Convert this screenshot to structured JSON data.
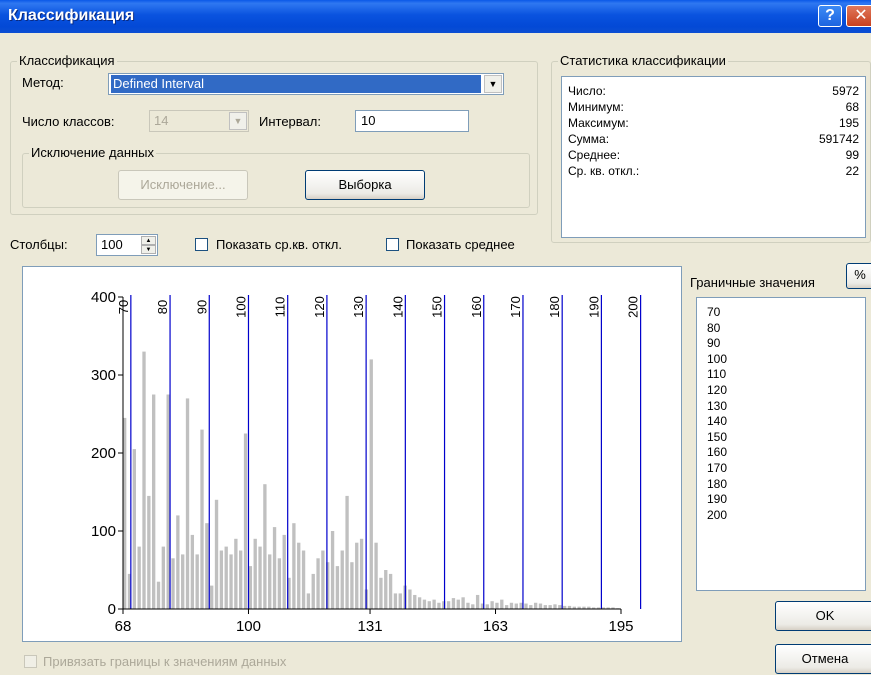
{
  "window": {
    "title": "Классификация"
  },
  "titlebar": {
    "help_glyph": "?",
    "close_glyph": "✕"
  },
  "classification": {
    "group_label": "Классификация",
    "method_label": "Метод:",
    "method_value": "Defined Interval",
    "classes_label": "Число классов:",
    "classes_value": "14",
    "interval_label": "Интервал:",
    "interval_value": "10"
  },
  "exclusion": {
    "group_label": "Исключение данных",
    "exclusion_button": "Исключение...",
    "sampling_button": "Выборка"
  },
  "statistics": {
    "group_label": "Статистика классификации",
    "rows": [
      {
        "key": "Число:",
        "value": "5972"
      },
      {
        "key": "Минимум:",
        "value": "68"
      },
      {
        "key": "Максимум:",
        "value": "195"
      },
      {
        "key": "Сумма:",
        "value": "591742"
      },
      {
        "key": "Среднее:",
        "value": "99"
      },
      {
        "key": "Ср. кв. откл.:",
        "value": "22"
      }
    ]
  },
  "columns": {
    "label": "Столбцы:",
    "value": "100",
    "show_std_label": "Показать ср.кв. откл.",
    "show_mean_label": "Показать среднее"
  },
  "breaks": {
    "label": "Граничные значения",
    "percent_button": "%",
    "values": [
      "70",
      "80",
      "90",
      "100",
      "110",
      "120",
      "130",
      "140",
      "150",
      "160",
      "170",
      "180",
      "190",
      "200"
    ]
  },
  "buttons": {
    "ok": "OK",
    "cancel": "Отмена"
  },
  "snap": {
    "label": "Привязать границы к значениям данных"
  },
  "colors": {
    "bar": "#c0c0c0",
    "break_line": "#0000cc"
  },
  "chart_data": {
    "type": "bar",
    "title": "",
    "xlim": [
      68,
      195
    ],
    "ylim": [
      0,
      400
    ],
    "x_ticks": [
      "68",
      "100",
      "131",
      "163",
      "195"
    ],
    "y_ticks": [
      "0",
      "100",
      "200",
      "300",
      "400"
    ],
    "break_values": [
      70,
      80,
      90,
      100,
      110,
      120,
      130,
      140,
      150,
      160,
      170,
      180,
      190,
      200
    ],
    "break_labels": [
      "70",
      "80",
      "90",
      "100",
      "110",
      "120",
      "130",
      "140",
      "150",
      "160",
      "170",
      "180",
      "190",
      "200"
    ],
    "values": [
      245,
      45,
      205,
      80,
      330,
      145,
      275,
      35,
      80,
      275,
      65,
      120,
      70,
      270,
      95,
      70,
      230,
      110,
      30,
      140,
      75,
      80,
      70,
      90,
      75,
      225,
      55,
      90,
      80,
      160,
      70,
      105,
      65,
      95,
      40,
      110,
      85,
      75,
      20,
      45,
      65,
      75,
      60,
      100,
      55,
      75,
      145,
      60,
      85,
      90,
      25,
      320,
      85,
      40,
      50,
      45,
      20,
      20,
      30,
      25,
      18,
      15,
      12,
      10,
      12,
      8,
      10,
      10,
      14,
      12,
      15,
      8,
      6,
      18,
      7,
      6,
      10,
      8,
      12,
      5,
      8,
      7,
      8,
      7,
      5,
      8,
      7,
      5,
      5,
      6,
      5,
      4,
      4,
      3,
      3,
      3,
      3,
      2,
      2,
      2,
      2,
      2,
      1
    ]
  }
}
